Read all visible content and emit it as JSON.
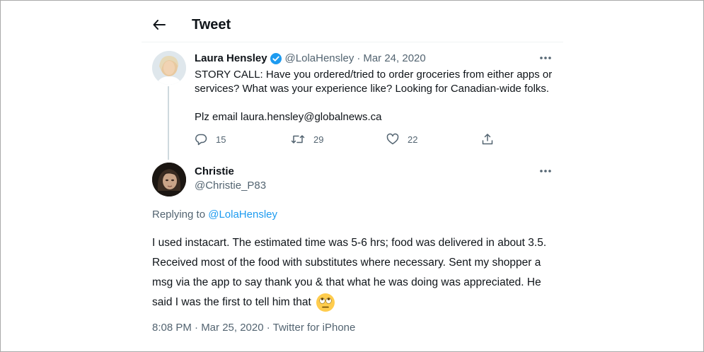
{
  "header": {
    "title": "Tweet"
  },
  "parent_tweet": {
    "display_name": "Laura Hensley",
    "handle": "@LolaHensley",
    "separator": "·",
    "date": "Mar 24, 2020",
    "text_lines": [
      "STORY CALL: Have you ordered/tried to order groceries from either apps or",
      "services? What was your experience like? Looking for Canadian-wide folks."
    ],
    "text_line_2": "Plz email laura.hensley@globalnews.ca",
    "reply_count": "15",
    "retweet_count": "29",
    "like_count": "22"
  },
  "main_tweet": {
    "display_name": "Christie",
    "handle": "@Christie_P83",
    "replying_prefix": "Replying to",
    "replying_to": "@LolaHensley",
    "text": "I used instacart. The estimated time was 5-6 hrs; food was delivered in about 3.5. Received most of the food with substitutes where necessary.  Sent my shopper a msg via the app to say thank you & that what he was doing was appreciated. He said I was the first to tell him that",
    "emoji": "face-with-rolling-eyes",
    "timestamp": "8:08 PM · Mar 25, 2020 · Twitter for iPhone"
  },
  "colors": {
    "text_primary": "#0f1419",
    "text_secondary": "#536471",
    "link": "#1d9bf0",
    "verified": "#1d9bf0",
    "divider": "#eff3f4"
  },
  "icons": [
    "back-arrow-icon",
    "verified-badge-icon",
    "more-icon",
    "reply-icon",
    "retweet-icon",
    "like-icon",
    "share-icon"
  ]
}
